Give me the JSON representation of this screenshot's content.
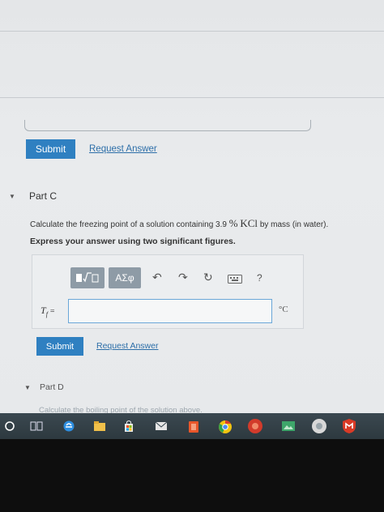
{
  "part_b": {
    "submit_label": "Submit",
    "request_answer_label": "Request Answer"
  },
  "part_c": {
    "title": "Part C",
    "question_prefix": "Calculate the freezing point of a solution containing 3.9",
    "question_percent": "%",
    "question_formula": "KCl",
    "question_suffix": "by mass (in water).",
    "instruction": "Express your answer using two significant figures.",
    "toolbar": {
      "templates_label": "√",
      "greek_label": "ΑΣφ",
      "help_label": "?"
    },
    "answer": {
      "variable": "T",
      "variable_sub": "f",
      "equals": "=",
      "value": "",
      "unit": "°C"
    },
    "submit_label": "Submit",
    "request_answer_label": "Request Answer"
  },
  "part_d": {
    "title": "Part D",
    "prompt": "Calculate the boiling point of the solution above."
  },
  "icons": {
    "undo": "undo-icon",
    "redo": "redo-icon",
    "reset": "reset-icon",
    "keyboard": "keyboard-icon",
    "help": "help-icon",
    "taskbar": [
      "start-icon",
      "task-view-icon",
      "edge-icon",
      "file-explorer-icon",
      "store-icon",
      "mail-icon",
      "office-icon",
      "chrome-icon",
      "media-icon",
      "photos-icon",
      "groove-icon",
      "mcafee-icon"
    ]
  },
  "colors": {
    "accent": "#2f80c1",
    "link": "#2c6ea8",
    "toolbar": "#8e9ba6",
    "taskbar": "#34424a"
  }
}
